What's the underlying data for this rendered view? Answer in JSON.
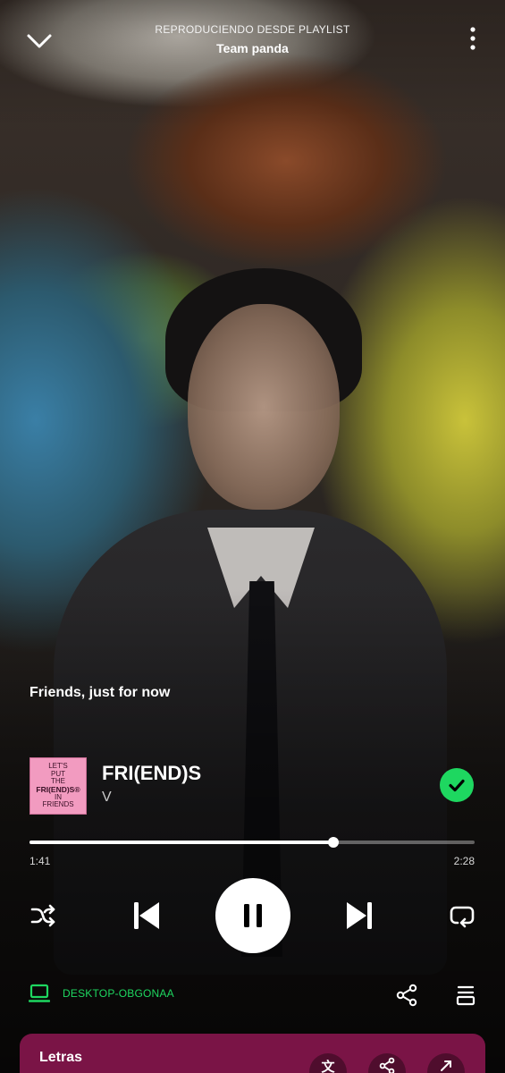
{
  "header": {
    "context_label": "REPRODUCIENDO DESDE PLAYLIST",
    "playlist_name": "Team panda"
  },
  "lyric_line": "Friends, just for now",
  "track": {
    "title": "FRI(END)S",
    "artist": "V",
    "liked": true,
    "cover_text": {
      "line1": "LET'S",
      "line2": "PUT",
      "line3": "THE",
      "line4": "FRI(END)S®",
      "line5": "IN",
      "line6": "FRIENDS"
    }
  },
  "playback": {
    "elapsed": "1:41",
    "total": "2:28",
    "progress_fraction": 0.6824,
    "state": "playing"
  },
  "device": {
    "name": "DESKTOP-OBGONAA"
  },
  "lyrics_card": {
    "title": "Letras",
    "translate_glyph": "文"
  },
  "colors": {
    "accent_green": "#1ed760",
    "lyrics_card": "#7a1446",
    "cover_pink": "#f29bc0"
  },
  "icons": {
    "collapse": "chevron-down-icon",
    "more": "more-vertical-icon",
    "liked": "check-icon",
    "shuffle": "shuffle-icon",
    "previous": "skip-previous-icon",
    "pause": "pause-icon",
    "next": "skip-next-icon",
    "repeat": "repeat-icon",
    "device": "laptop-icon",
    "share": "share-icon",
    "queue": "queue-icon",
    "translate": "translate-icon",
    "expand": "expand-icon"
  }
}
